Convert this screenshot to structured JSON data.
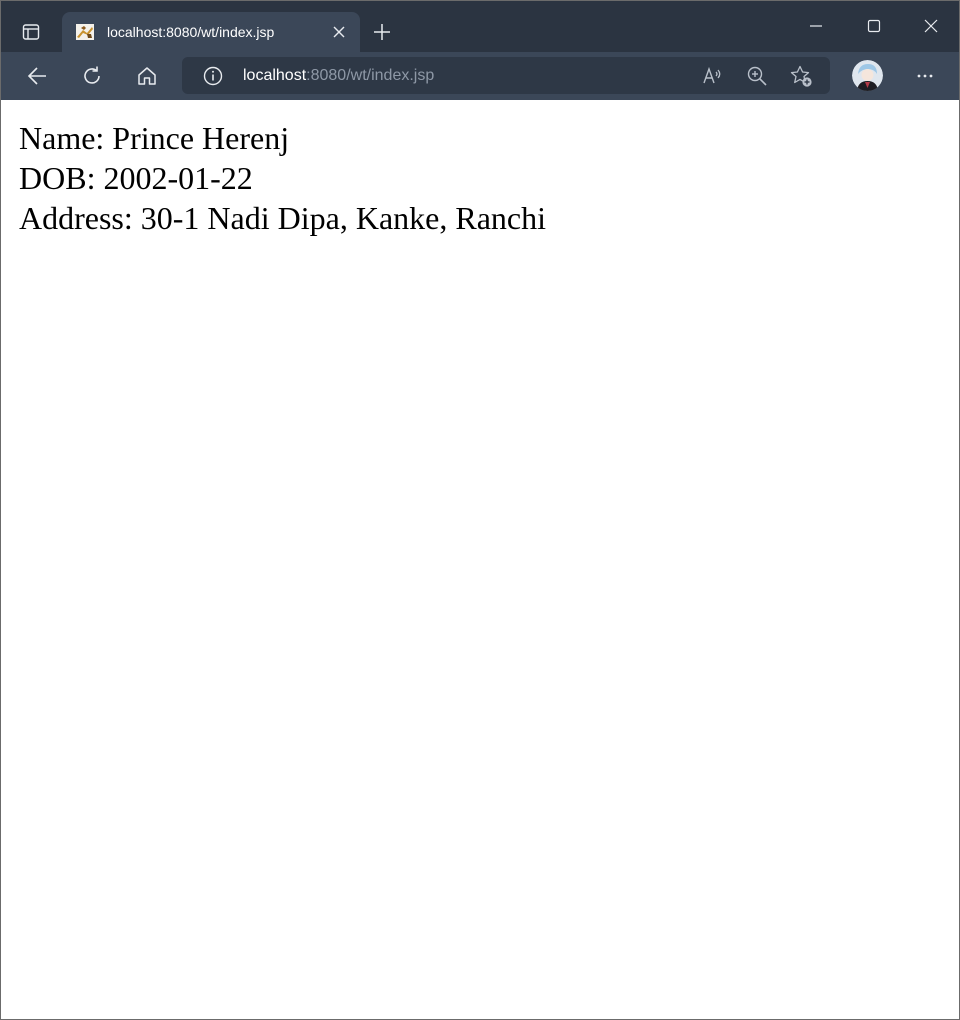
{
  "browser": {
    "tab": {
      "title": "localhost:8080/wt/index.jsp"
    },
    "address_bar": {
      "host": "localhost",
      "path": ":8080/wt/index.jsp"
    },
    "colors": {
      "titlebar": "#2b3441",
      "toolbar": "#3b4758",
      "addressbar": "#2e3846",
      "icon": "#e8ebef",
      "url_path": "#8e98a6"
    },
    "icons": {
      "tab_actions": "tab-actions-icon",
      "favicon": "tomcat-icon",
      "tab_close": "close-icon",
      "new_tab": "plus-icon",
      "minimize": "minimize-icon",
      "maximize": "maximize-icon",
      "close": "close-icon",
      "back": "back-arrow-icon",
      "refresh": "refresh-icon",
      "home": "home-icon",
      "site_info": "info-icon",
      "read_aloud": "read-aloud-icon",
      "zoom": "zoom-in-icon",
      "favorites": "add-favorite-icon",
      "profile": "avatar",
      "menu": "more-icon"
    }
  },
  "page": {
    "name_line": "Name: Prince Herenj",
    "dob_line": "DOB: 2002-01-22",
    "address_line": "Address: 30-1 Nadi Dipa, Kanke, Ranchi"
  }
}
